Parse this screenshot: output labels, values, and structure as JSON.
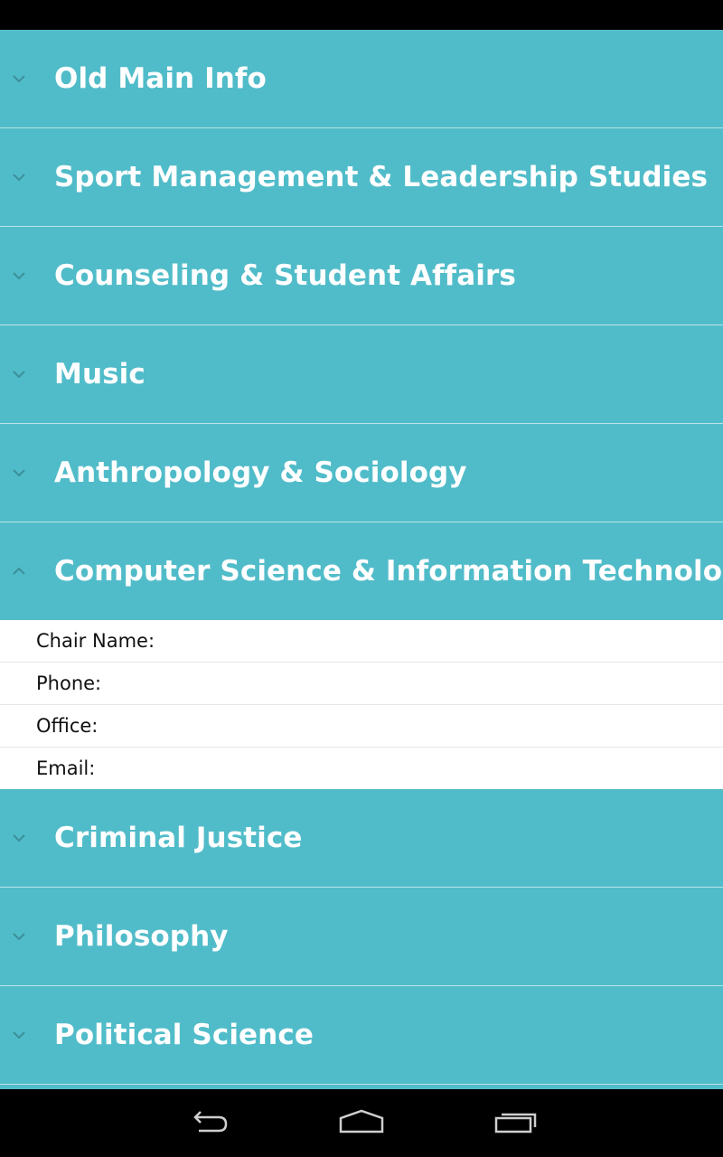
{
  "groups_before": [
    {
      "label": "Old Main Info",
      "icon": "chevron-down-icon"
    },
    {
      "label": "Sport Management & Leadership Studies",
      "icon": "chevron-down-icon"
    },
    {
      "label": "Counseling & Student Affairs",
      "icon": "chevron-down-icon"
    },
    {
      "label": "Music",
      "icon": "chevron-down-icon"
    },
    {
      "label": "Anthropology & Sociology",
      "icon": "chevron-down-icon"
    }
  ],
  "expanded_group": {
    "label": "Computer Science & Information Technology",
    "icon": "chevron-up-icon",
    "details": [
      "Chair Name:",
      "Phone:",
      "Office:",
      "Email:"
    ]
  },
  "groups_after": [
    {
      "label": "Criminal Justice",
      "icon": "chevron-down-icon"
    },
    {
      "label": "Philosophy",
      "icon": "chevron-down-icon"
    },
    {
      "label": "Political Science",
      "icon": "chevron-down-icon"
    }
  ],
  "nav": {
    "back_icon": "back-icon",
    "home_icon": "home-icon",
    "recents_icon": "recent-apps-icon"
  },
  "colors": {
    "group_background": "#51bcc9",
    "group_text": "#ffffff",
    "divider": "#b9e3e8",
    "chevron": "#3b8f99",
    "system_bar": "#000000"
  }
}
